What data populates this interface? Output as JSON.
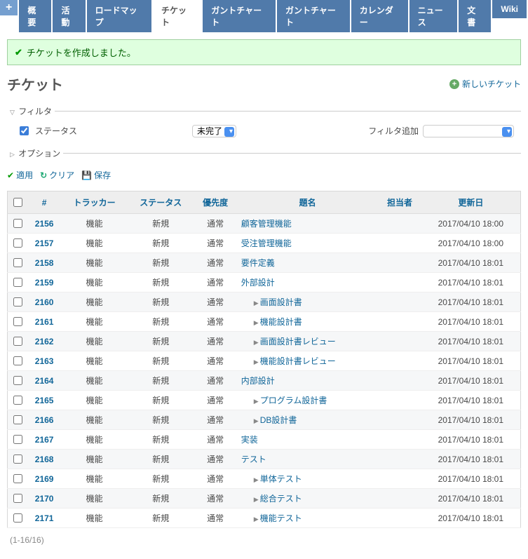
{
  "tabs": {
    "new_object": "+",
    "items": [
      {
        "label": "概要"
      },
      {
        "label": "活動"
      },
      {
        "label": "ロードマップ"
      },
      {
        "label": "チケット",
        "selected": true
      },
      {
        "label": "ガントチャート"
      },
      {
        "label": "ガントチャート"
      },
      {
        "label": "カレンダー"
      },
      {
        "label": "ニュース"
      },
      {
        "label": "文書"
      },
      {
        "label": "Wiki"
      }
    ]
  },
  "flash": {
    "message": "チケットを作成しました。"
  },
  "page_title": "チケット",
  "new_issue_label": "新しいチケット",
  "filters": {
    "legend": "フィルタ",
    "status_label": "ステータス",
    "status_value": "未完了",
    "add_filter_label": "フィルタ追加",
    "add_filter_value": ""
  },
  "options_legend": "オプション",
  "buttons": {
    "apply": "適用",
    "clear": "クリア",
    "save": "保存"
  },
  "columns": {
    "id": "#",
    "tracker": "トラッカー",
    "status": "ステータス",
    "priority": "優先度",
    "subject": "題名",
    "assignee": "担当者",
    "updated": "更新日"
  },
  "rows": [
    {
      "id": "2156",
      "tracker": "機能",
      "status": "新規",
      "priority": "通常",
      "subject": "顧客管理機能",
      "level": 0,
      "updated": "2017/04/10 18:00"
    },
    {
      "id": "2157",
      "tracker": "機能",
      "status": "新規",
      "priority": "通常",
      "subject": "受注管理機能",
      "level": 0,
      "updated": "2017/04/10 18:00"
    },
    {
      "id": "2158",
      "tracker": "機能",
      "status": "新規",
      "priority": "通常",
      "subject": "要件定義",
      "level": 0,
      "updated": "2017/04/10 18:01"
    },
    {
      "id": "2159",
      "tracker": "機能",
      "status": "新規",
      "priority": "通常",
      "subject": "外部設計",
      "level": 0,
      "updated": "2017/04/10 18:01"
    },
    {
      "id": "2160",
      "tracker": "機能",
      "status": "新規",
      "priority": "通常",
      "subject": "画面設計書",
      "level": 1,
      "updated": "2017/04/10 18:01"
    },
    {
      "id": "2161",
      "tracker": "機能",
      "status": "新規",
      "priority": "通常",
      "subject": "機能設計書",
      "level": 1,
      "updated": "2017/04/10 18:01"
    },
    {
      "id": "2162",
      "tracker": "機能",
      "status": "新規",
      "priority": "通常",
      "subject": "画面設計書レビュー",
      "level": 1,
      "updated": "2017/04/10 18:01"
    },
    {
      "id": "2163",
      "tracker": "機能",
      "status": "新規",
      "priority": "通常",
      "subject": "機能設計書レビュー",
      "level": 1,
      "updated": "2017/04/10 18:01"
    },
    {
      "id": "2164",
      "tracker": "機能",
      "status": "新規",
      "priority": "通常",
      "subject": "内部設計",
      "level": 0,
      "updated": "2017/04/10 18:01"
    },
    {
      "id": "2165",
      "tracker": "機能",
      "status": "新規",
      "priority": "通常",
      "subject": "プログラム設計書",
      "level": 1,
      "updated": "2017/04/10 18:01"
    },
    {
      "id": "2166",
      "tracker": "機能",
      "status": "新規",
      "priority": "通常",
      "subject": "DB設計書",
      "level": 1,
      "updated": "2017/04/10 18:01"
    },
    {
      "id": "2167",
      "tracker": "機能",
      "status": "新規",
      "priority": "通常",
      "subject": "実装",
      "level": 0,
      "updated": "2017/04/10 18:01"
    },
    {
      "id": "2168",
      "tracker": "機能",
      "status": "新規",
      "priority": "通常",
      "subject": "テスト",
      "level": 0,
      "updated": "2017/04/10 18:01"
    },
    {
      "id": "2169",
      "tracker": "機能",
      "status": "新規",
      "priority": "通常",
      "subject": "単体テスト",
      "level": 1,
      "updated": "2017/04/10 18:01"
    },
    {
      "id": "2170",
      "tracker": "機能",
      "status": "新規",
      "priority": "通常",
      "subject": "総合テスト",
      "level": 1,
      "updated": "2017/04/10 18:01"
    },
    {
      "id": "2171",
      "tracker": "機能",
      "status": "新規",
      "priority": "通常",
      "subject": "機能テスト",
      "level": 1,
      "updated": "2017/04/10 18:01"
    }
  ],
  "pagination": "(1-16/16)"
}
